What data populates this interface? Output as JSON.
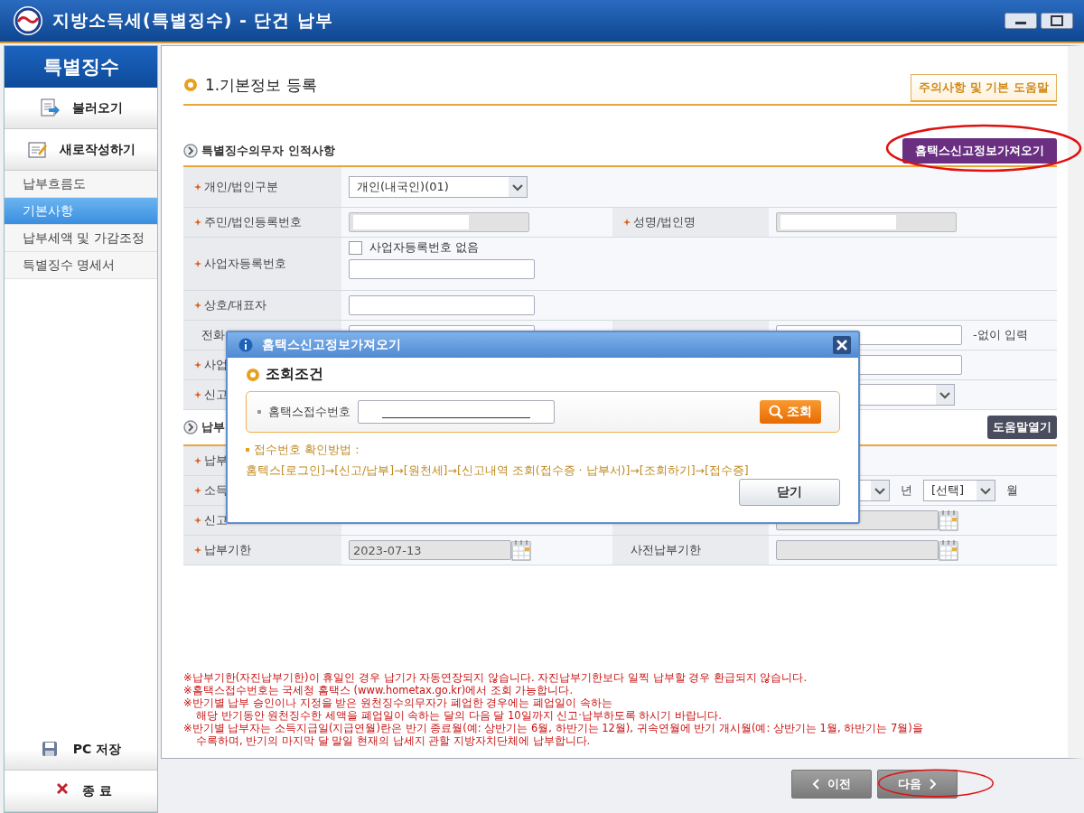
{
  "window": {
    "title": "지방소득세(특별징수) - 단건 납부"
  },
  "sidebar": {
    "title": "특별징수",
    "actions": [
      {
        "kind": "load",
        "label": "불러오기"
      },
      {
        "kind": "new",
        "label": "새로작성하기"
      }
    ],
    "items": [
      {
        "label": "납부흐름도",
        "selected": false
      },
      {
        "label": "기본사항",
        "selected": true
      },
      {
        "label": "납부세액 및 가감조정",
        "selected": false
      },
      {
        "label": "특별징수 명세서",
        "selected": false
      }
    ],
    "bottom_actions": [
      {
        "kind": "save",
        "label": "PC 저장"
      },
      {
        "kind": "exit",
        "label": "종 료"
      }
    ]
  },
  "page": {
    "title": "1.기본정보 등록",
    "help_tab": "주의사항 및 기본 도움말"
  },
  "sections": [
    {
      "title": "특별징수의무자 인적사항",
      "button": {
        "label": "홈택스신고정보가져오기",
        "highlighted": true
      },
      "rows": [
        {
          "label": "개인/법인구분",
          "required": true,
          "controls": [
            {
              "kind": "select",
              "value": "개인(내국인)(01)"
            }
          ]
        },
        {
          "label": "주민/법인등록번호",
          "required": true,
          "controls": [
            {
              "kind": "masked"
            }
          ],
          "right": {
            "label": "성명/법인명",
            "required": true,
            "controls": [
              {
                "kind": "masked"
              }
            ]
          }
        },
        {
          "label": "사업자등록번호",
          "required": true,
          "controls": [
            {
              "kind": "checkbox",
              "label": "사업자등록번호 없음",
              "checked": false
            },
            {
              "kind": "input"
            }
          ]
        },
        {
          "label": "상호/대표자",
          "required": true,
          "controls": [
            {
              "kind": "input"
            }
          ]
        },
        {
          "label": "전화",
          "required": false,
          "controls": [
            {
              "kind": "input"
            }
          ],
          "right": {
            "required": false,
            "controls": [
              {
                "kind": "input"
              },
              {
                "kind": "note",
                "text": "-없이 입력"
              }
            ]
          }
        },
        {
          "label": "사업",
          "required": true,
          "controls": [],
          "right": {
            "required": false,
            "controls": [
              {
                "kind": "input"
              }
            ]
          }
        },
        {
          "label": "신고",
          "required": true,
          "controls": [],
          "right": {
            "required": false,
            "controls": [
              {
                "kind": "select"
              }
            ]
          }
        }
      ]
    },
    {
      "title": "납부",
      "button": {
        "label": "도움말열기",
        "highlighted": false
      },
      "rows": [
        {
          "label": "납부",
          "required": true,
          "controls": []
        },
        {
          "label": "소득",
          "required": true,
          "controls": [],
          "right": {
            "required": false,
            "controls": [
              {
                "kind": "select"
              },
              {
                "kind": "note",
                "text": "년"
              },
              {
                "kind": "select",
                "value": "[선택]"
              },
              {
                "kind": "note",
                "text": "월"
              }
            ]
          }
        },
        {
          "label": "신고",
          "required": true,
          "controls": [],
          "right": {
            "required": false,
            "controls": [
              {
                "kind": "date",
                "disabled": true
              }
            ]
          }
        },
        {
          "label": "납부기한",
          "required": true,
          "controls": [
            {
              "kind": "date",
              "value": "2023-07-13",
              "disabled": true
            }
          ],
          "right": {
            "label": "사전납부기한",
            "required": false,
            "controls": [
              {
                "kind": "date",
                "disabled": true
              }
            ]
          }
        }
      ]
    }
  ],
  "notes": [
    {
      "lines": [
        "※납부기한(자진납부기한)이 휴일인 경우 납기가 자동연장되지 않습니다. 자진납부기한보다 일찍 납부할 경우 환급되지 않습니다."
      ]
    },
    {
      "lines": [
        "※홈택스접수번호는 국세청 홈택스 (www.hometax.go.kr)에서 조회 가능합니다."
      ]
    },
    {
      "lines": [
        "※반기별 납부 승인이나 지정을 받은 원천징수의무자가 폐업한 경우에는 폐업일이 속하는",
        "해당 반기동안 원천징수한 세액을 폐업일이 속하는 달의 다음 달 10일까지 신고·납부하도록 하시기 바랍니다."
      ]
    },
    {
      "lines": [
        "※반기별 납부자는 소득지급일(지급연월)란은 반기 종료월(예: 상반기는 6월, 하반기는 12월), 귀속연월에 반기 개시월(예: 상반기는 1월, 하반기는 7월)을",
        "수록하며, 반기의 마지막 달 말일 현재의 납세지 관할 지방자치단체에 납부합니다."
      ]
    }
  ],
  "footer": {
    "buttons": [
      {
        "kind": "prev",
        "label": "이전",
        "highlighted": false
      },
      {
        "kind": "next",
        "label": "다음",
        "highlighted": true
      }
    ]
  },
  "dialog": {
    "title": "홈택스신고정보가져오기",
    "section": "조회조건",
    "field": {
      "label": "홈택스접수번호"
    },
    "search_button": "조회",
    "guide_title": "접수번호 확인방법 :",
    "guide_text": "홈텍스[로그인]→[신고/납부]→[원천세]→[신고내역 조회(접수증 · 납부서)]→[조회하기]→[접수증]",
    "close_button": "닫기"
  }
}
